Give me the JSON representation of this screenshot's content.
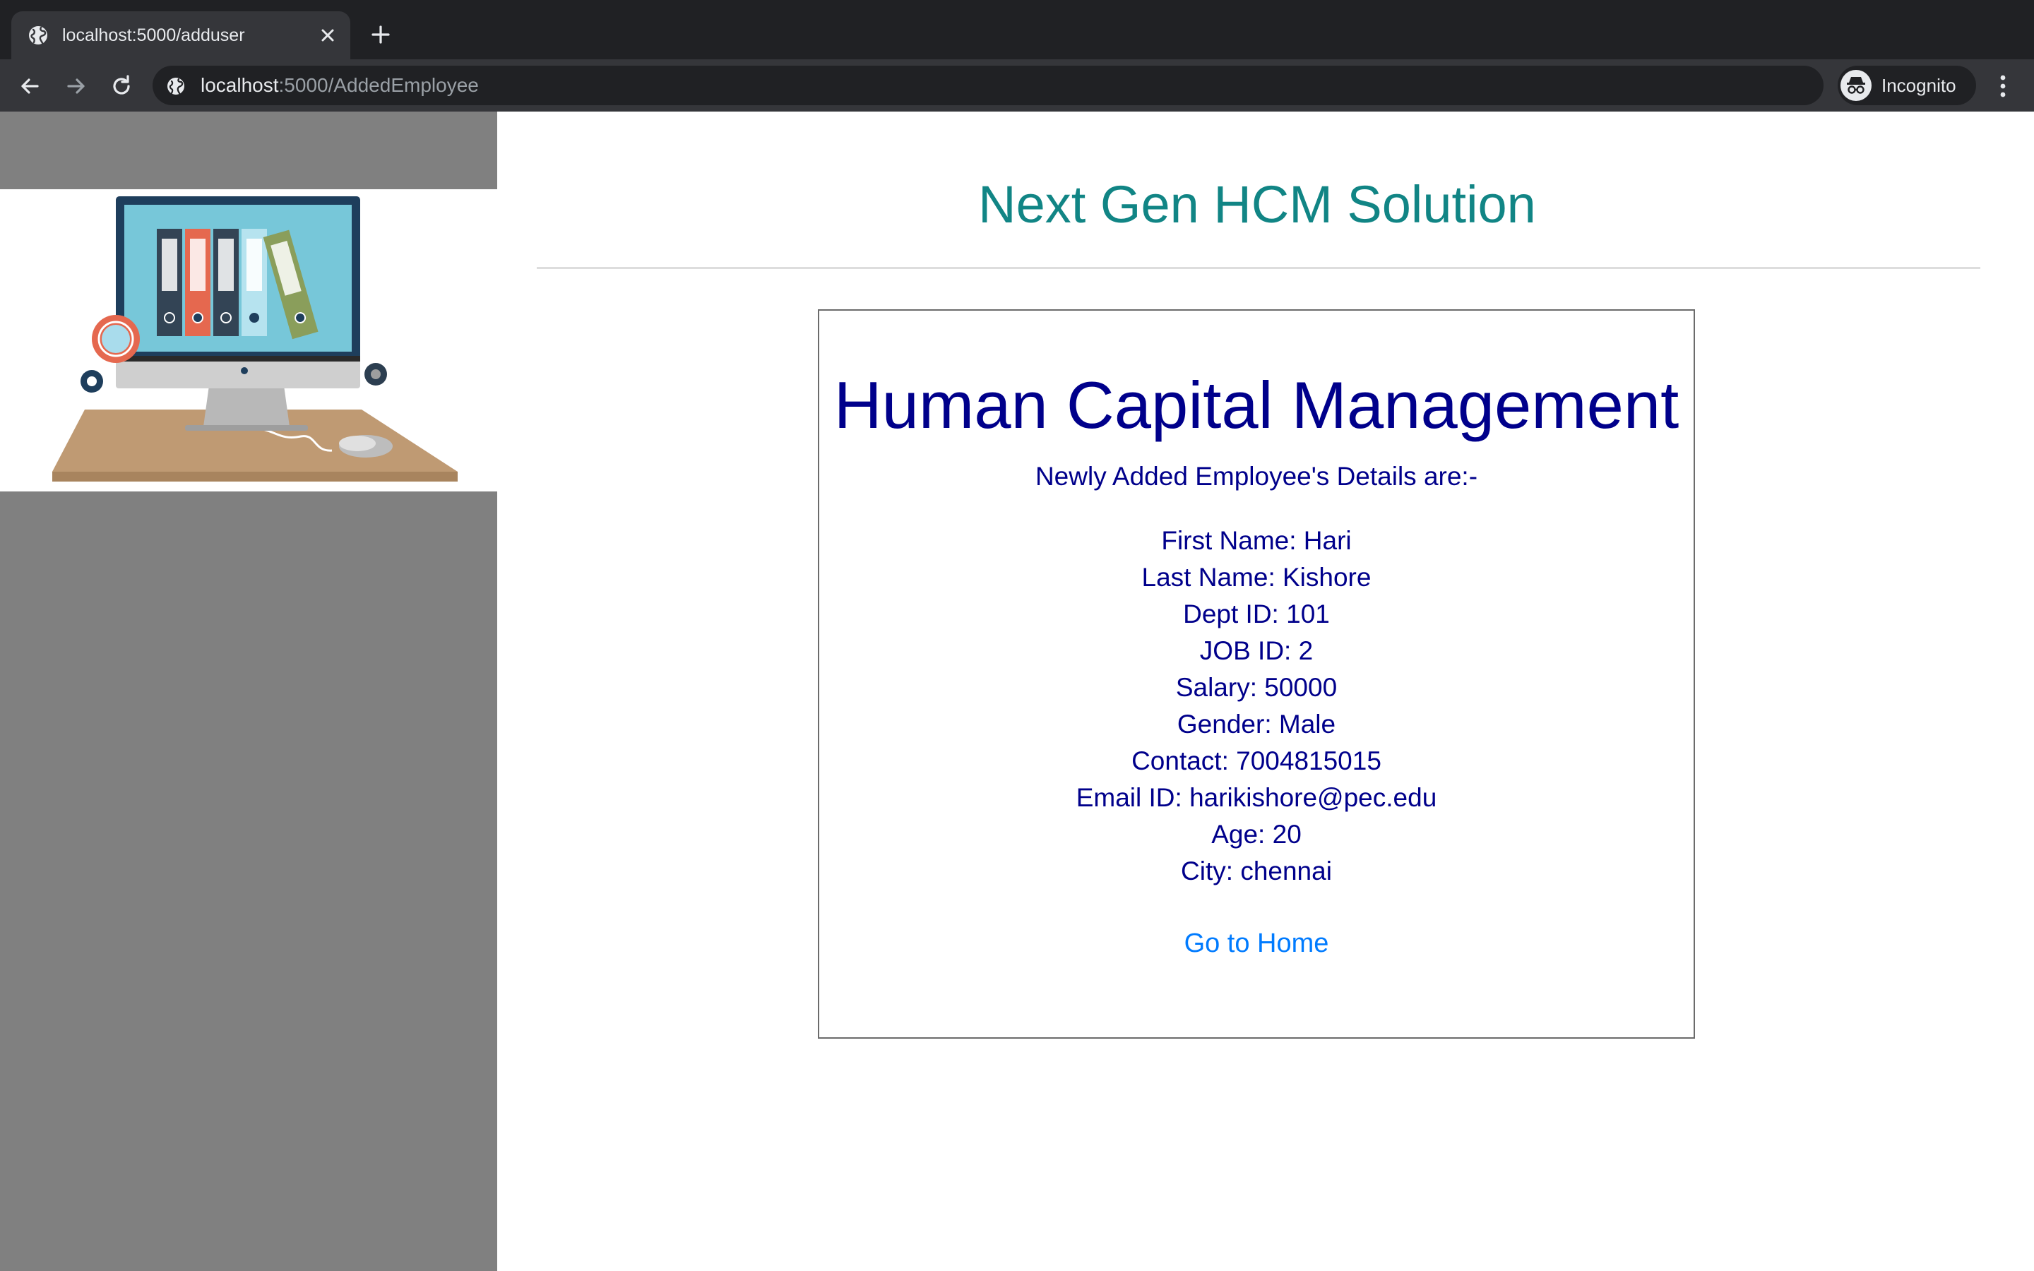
{
  "browser": {
    "tab": {
      "title": "localhost:5000/adduser"
    },
    "address_bar": {
      "host": "localhost",
      "path": ":5000/AddedEmployee"
    },
    "profile": {
      "label": "Incognito"
    }
  },
  "page": {
    "site_title": "Next Gen HCM Solution",
    "card": {
      "title": "Human Capital Management",
      "subtitle": "Newly Added Employee's Details are:-",
      "details": [
        "First Name: Hari",
        "Last Name: Kishore",
        "Dept ID: 101",
        "JOB ID: 2",
        "Salary: 50000",
        "Gender: Male",
        "Contact: 7004815015",
        "Email ID: harikishore@pec.edu",
        "Age: 20",
        "City: chennai"
      ],
      "home_link": "Go to Home"
    }
  },
  "icons": {
    "tab_favicon": "globe-icon",
    "tab_close": "close-icon",
    "new_tab": "plus-icon",
    "back": "back-arrow-icon",
    "forward": "forward-arrow-icon",
    "reload": "reload-icon",
    "site_info": "site-info-icon",
    "profile": "incognito-icon",
    "menu": "kebab-menu-icon"
  },
  "colors": {
    "site_title": "#118585",
    "card_text": "#00008b",
    "link": "#007bff",
    "sidebar": "#808080"
  }
}
